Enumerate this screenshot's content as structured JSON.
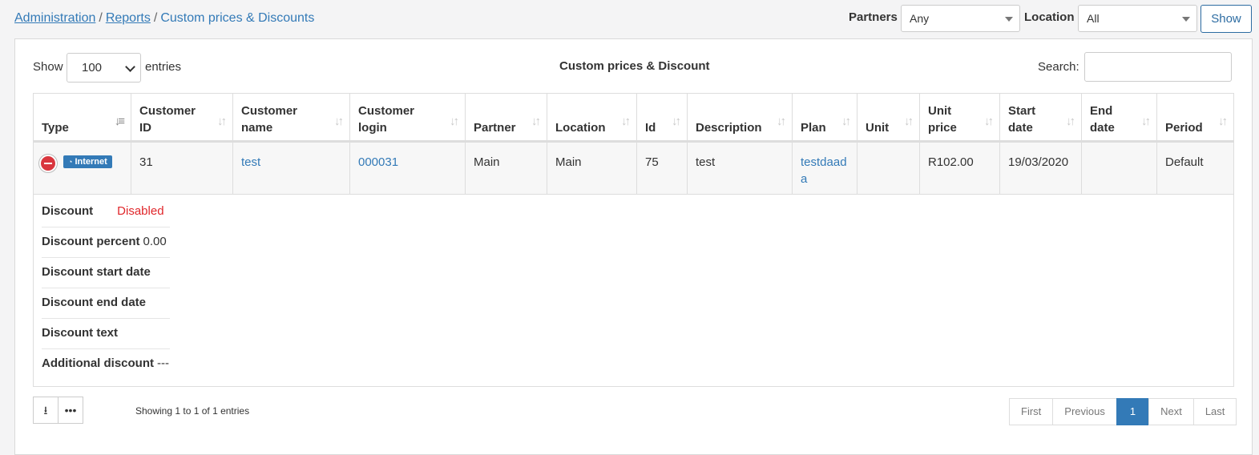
{
  "breadcrumb": {
    "items": [
      "Administration",
      "Reports"
    ],
    "current": "Custom prices & Discounts"
  },
  "filters": {
    "partners_label": "Partners",
    "partners_value": "Any",
    "location_label": "Location",
    "location_value": "All",
    "show_button": "Show"
  },
  "table_controls": {
    "show_label": "Show",
    "entries_value": "100",
    "entries_label": "entries",
    "title": "Custom prices & Discount",
    "search_label": "Search:"
  },
  "columns": [
    "Type",
    "Customer ID",
    "Customer name",
    "Customer login",
    "Partner",
    "Location",
    "Id",
    "Description",
    "Plan",
    "Unit",
    "Unit price",
    "Start date",
    "End date",
    "Period"
  ],
  "row": {
    "type_badge": "Internet",
    "customer_id": "31",
    "customer_name": "test",
    "customer_login": "000031",
    "partner": "Main",
    "location": "Main",
    "id": "75",
    "description": "test",
    "plan": "testdaada",
    "unit": "",
    "unit_price": "R102.00",
    "start_date": "19/03/2020",
    "end_date": "",
    "period": "Default"
  },
  "details": [
    {
      "key": "Discount",
      "value": "Disabled"
    },
    {
      "key": "Discount percent",
      "value": "0.00"
    },
    {
      "key": "Discount start date",
      "value": ""
    },
    {
      "key": "Discount end date",
      "value": ""
    },
    {
      "key": "Discount text",
      "value": ""
    },
    {
      "key": "Additional discount",
      "value": "---"
    }
  ],
  "footer": {
    "info": "Showing 1 to 1 of 1 entries",
    "pager": [
      "First",
      "Previous",
      "1",
      "Next",
      "Last"
    ],
    "active_page": "1"
  },
  "colors": {
    "accent": "#337ab7",
    "disabled": "#e0262a",
    "remove": "#d9363e"
  }
}
